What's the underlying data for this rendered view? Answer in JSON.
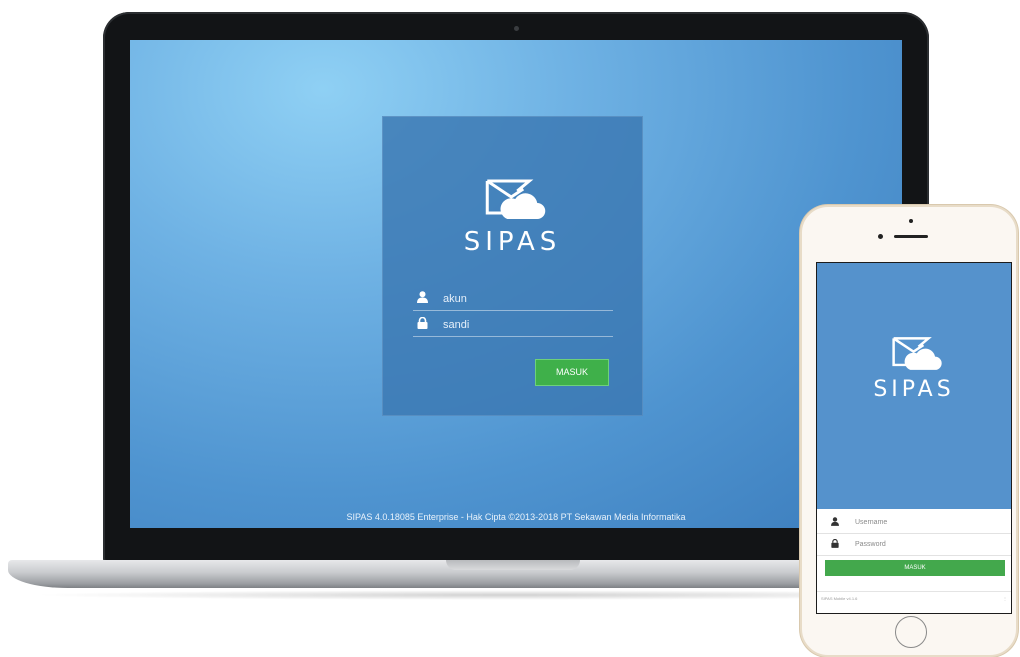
{
  "laptop": {
    "app_name": "SIPAS",
    "username_value": "akun",
    "password_value": "sandi",
    "login_button": "MASUK",
    "footer": "SIPAS 4.0.18085 Enterprise - Hak Cipta ©2013-2018 PT Sekawan Media Informatika"
  },
  "phone": {
    "app_name": "SIPAS",
    "username_placeholder": "Username",
    "password_placeholder": "Password",
    "login_button": "MASUK",
    "footer_left": "SIPAS Mobile v4.1.6",
    "footer_right": "⋮"
  },
  "icons": {
    "user": "user-icon",
    "lock": "lock-icon",
    "logo": "envelope-cloud-icon"
  },
  "colors": {
    "screen_blue": "#5592cc",
    "panel_blue": "#3a78b2",
    "button_green": "#3fb04a"
  }
}
